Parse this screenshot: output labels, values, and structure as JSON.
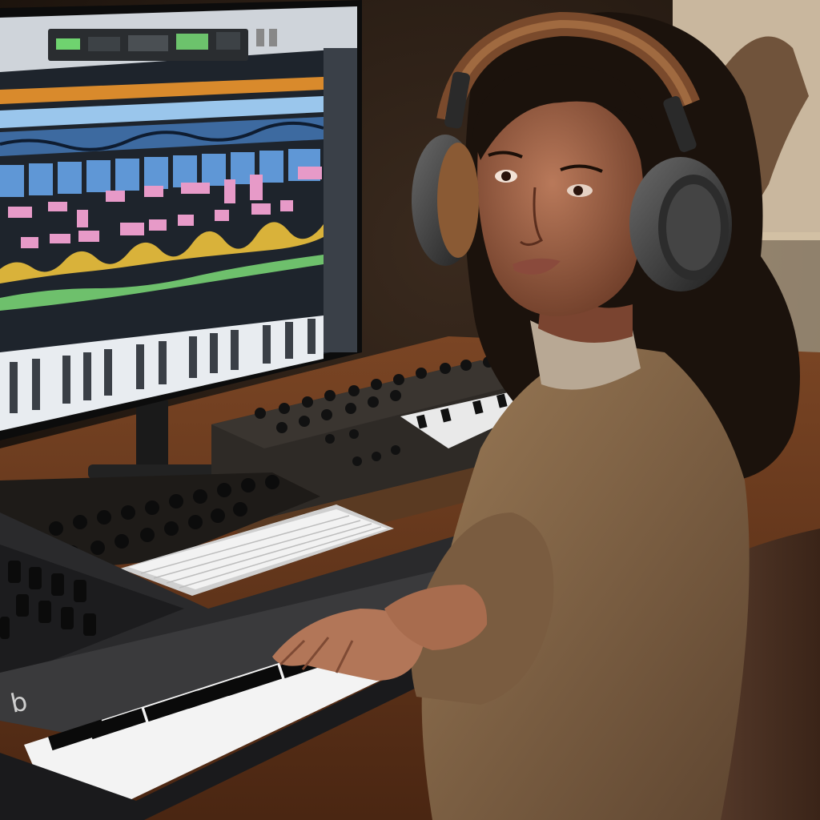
{
  "scene": {
    "subjects": [
      {
        "name": "music-producer",
        "description_visible": true
      },
      {
        "name": "daw-monitor"
      },
      {
        "name": "midi-keyboard-front"
      },
      {
        "name": "midi-controller-back"
      },
      {
        "name": "mixer-controller"
      },
      {
        "name": "computer-keyboard"
      },
      {
        "name": "headphones"
      },
      {
        "name": "office-chair"
      }
    ],
    "keyboard_front_label": "b"
  },
  "colors": {
    "background_wall": "#2a1d14",
    "desk_wood": "#6b3b1e",
    "sweater": "#8a6a48",
    "headphone_cushion": "#8a5a34",
    "screen_bg": "#1e242c",
    "clip_pink": "#e79ac8",
    "clip_blue": "#5f97d6",
    "wave_orange": "#d98a2c",
    "wave_green": "#6ec06c",
    "wave_yellow": "#d9b23a"
  }
}
